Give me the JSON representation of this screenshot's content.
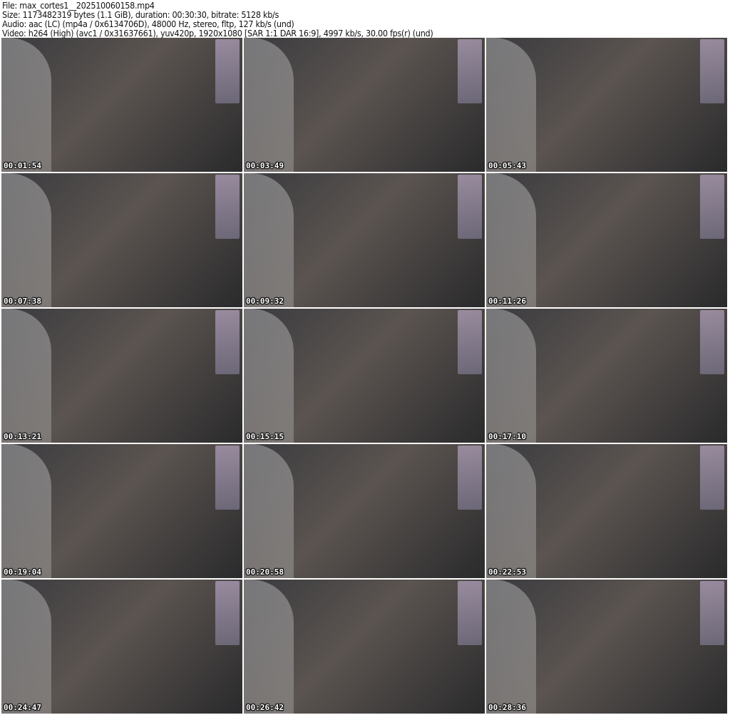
{
  "header": {
    "file": "File: max_cortes1__202510060158.mp4",
    "size": "Size: 1173482319 bytes (1.1 GiB), duration: 00:30:30, bitrate: 5128 kb/s",
    "audio": "Audio: aac (LC) (mp4a / 0x6134706D), 48000 Hz, stereo, fltp, 127 kb/s (und)",
    "video": "Video: h264 (High) (avc1 / 0x31637661), yuv420p, 1920x1080 [SAR 1:1 DAR 16:9], 4997 kb/s, 30.00 fps(r) (und)"
  },
  "thumbnails": [
    "00:01:54",
    "00:03:49",
    "00:05:43",
    "00:07:38",
    "00:09:32",
    "00:11:26",
    "00:13:21",
    "00:15:15",
    "00:17:10",
    "00:19:04",
    "00:20:58",
    "00:22:53",
    "00:24:47",
    "00:26:42",
    "00:28:36"
  ]
}
